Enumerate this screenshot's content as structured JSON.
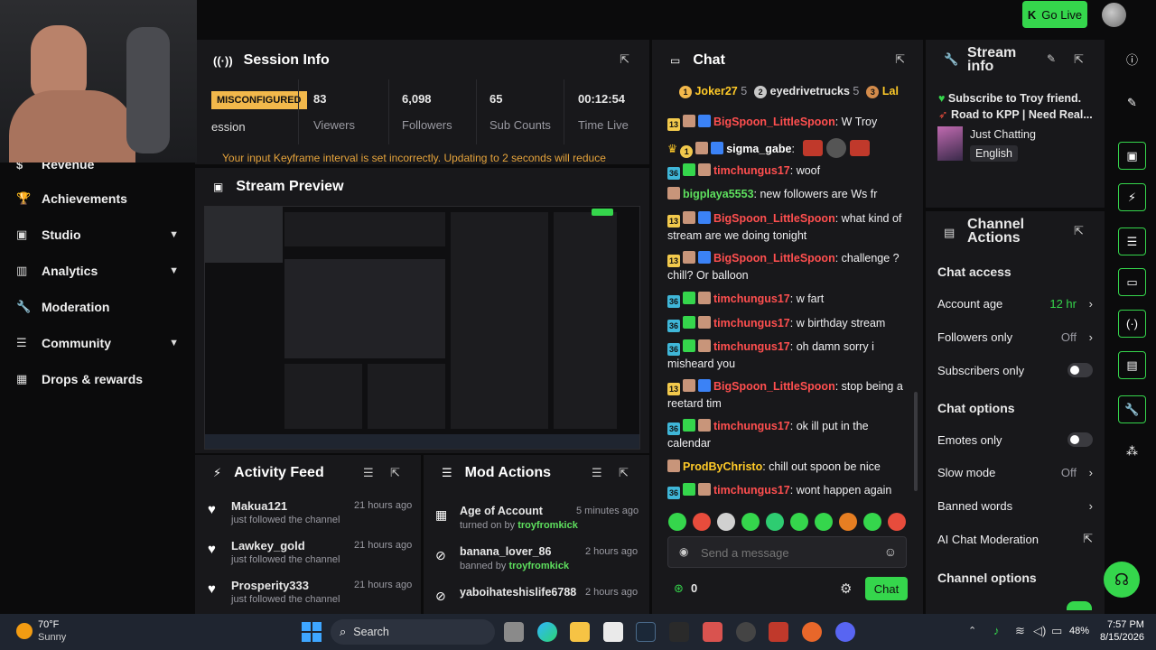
{
  "header": {
    "go_live_label": "Go Live"
  },
  "sidebar": {
    "items": [
      {
        "label": "Revenue",
        "icon": "dollar-icon",
        "expandable": false
      },
      {
        "label": "Achievements",
        "icon": "trophy-icon",
        "expandable": false
      },
      {
        "label": "Studio",
        "icon": "studio-icon",
        "expandable": true
      },
      {
        "label": "Analytics",
        "icon": "chart-icon",
        "expandable": true
      },
      {
        "label": "Moderation",
        "icon": "wrench-icon",
        "expandable": false
      },
      {
        "label": "Community",
        "icon": "community-icon",
        "expandable": true
      },
      {
        "label": "Drops & rewards",
        "icon": "drops-icon",
        "expandable": false
      }
    ]
  },
  "session": {
    "title": "Session Info",
    "status_badge": "MISCONFIGURED",
    "status_label": "ession",
    "stats": [
      {
        "value": "83",
        "label": "Viewers"
      },
      {
        "value": "6,098",
        "label": "Followers"
      },
      {
        "value": "65",
        "label": "Sub Counts"
      },
      {
        "value": "00:12:54",
        "label": "Time Live"
      }
    ],
    "warning": "Your input Keyframe interval is set incorrectly. Updating to 2 seconds will reduce"
  },
  "preview": {
    "title": "Stream Preview"
  },
  "activity": {
    "title": "Activity Feed",
    "items": [
      {
        "name": "Makua121",
        "time": "21 hours ago",
        "desc": "just followed the channel"
      },
      {
        "name": "Lawkey_gold",
        "time": "21 hours ago",
        "desc": "just followed the channel"
      },
      {
        "name": "Prosperity333",
        "time": "21 hours ago",
        "desc": "just followed the channel"
      }
    ]
  },
  "mod_actions": {
    "title": "Mod Actions",
    "items": [
      {
        "name": "Age of Account",
        "time": "5 minutes ago",
        "desc_prefix": "turned on by",
        "by": "troyfromkick"
      },
      {
        "name": "banana_lover_86",
        "time": "2 hours ago",
        "desc_prefix": "banned by",
        "by": "troyfromkick"
      },
      {
        "name": "yaboihateshislife6788",
        "time": "2 hours ago",
        "desc_prefix": "",
        "by": ""
      }
    ]
  },
  "chat": {
    "title": "Chat",
    "leaders": [
      {
        "rank": "1",
        "name": "Joker27",
        "count": "5"
      },
      {
        "rank": "2",
        "name": "eyedrivetrucks",
        "count": "5"
      },
      {
        "rank": "3",
        "name": "Lal",
        "count": ""
      }
    ],
    "messages": [
      {
        "sub": "13",
        "user": "BigSpoon_LittleSpoon",
        "color": "red",
        "text": ": W Troy",
        "mod": true
      },
      {
        "sub": "1",
        "user": "sigma_gabe",
        "color": "white",
        "text": ":",
        "mod": true,
        "crown": true
      },
      {
        "sub": "36",
        "user": "timchungus17",
        "color": "red",
        "text": ": woof",
        "mod": false
      },
      {
        "sub": "",
        "user": "bigplaya5553",
        "color": "green",
        "text": ": new followers are Ws fr",
        "mod": false
      },
      {
        "sub": "13",
        "user": "BigSpoon_LittleSpoon",
        "color": "red",
        "text": ": what kind of stream are we doing tonight",
        "mod": true
      },
      {
        "sub": "13",
        "user": "BigSpoon_LittleSpoon",
        "color": "red",
        "text": ": challenge ? chill? Or balloon",
        "mod": true
      },
      {
        "sub": "36",
        "user": "timchungus17",
        "color": "red",
        "text": ": w fart",
        "mod": false
      },
      {
        "sub": "36",
        "user": "timchungus17",
        "color": "red",
        "text": ": w birthday stream",
        "mod": false
      },
      {
        "sub": "36",
        "user": "timchungus17",
        "color": "red",
        "text": ": oh damn sorry i misheard you",
        "mod": false
      },
      {
        "sub": "13",
        "user": "BigSpoon_LittleSpoon",
        "color": "red",
        "text": ": stop being a reetard tim",
        "mod": true
      },
      {
        "sub": "36",
        "user": "timchungus17",
        "color": "red",
        "text": ": ok ill put in the calendar",
        "mod": false
      },
      {
        "sub": "",
        "user": "ProdByChristo",
        "color": "yellow",
        "text": ": chill out spoon be nice",
        "mod": false
      },
      {
        "sub": "36",
        "user": "timchungus17",
        "color": "red",
        "text": ": wont happen again",
        "mod": false
      }
    ],
    "input_placeholder": "Send a message",
    "points": "0",
    "send_label": "Chat"
  },
  "stream_info": {
    "title": "Stream info",
    "line1": "Subscribe to Troy friend.",
    "line2": "Road to KPP | Need Real...",
    "category": "Just Chatting",
    "language": "English"
  },
  "channel_actions": {
    "title": "Channel Actions",
    "chat_access_heading": "Chat access",
    "account_age_label": "Account age",
    "account_age_value": "12 hr",
    "followers_only_label": "Followers only",
    "followers_only_value": "Off",
    "subscribers_only_label": "Subscribers only",
    "chat_options_heading": "Chat options",
    "emotes_only_label": "Emotes only",
    "slow_mode_label": "Slow mode",
    "slow_mode_value": "Off",
    "banned_words_label": "Banned words",
    "ai_moderation_label": "AI Chat Moderation",
    "channel_options_heading": "Channel options"
  },
  "taskbar": {
    "weather_temp": "70°F",
    "weather_desc": "Sunny",
    "search_label": "Search",
    "battery": "48%",
    "time": "7:57 PM",
    "date": "8/15/2026"
  },
  "colors": {
    "accent": "#35d64c",
    "panel": "#18181b",
    "background": "#0b0b0c"
  }
}
